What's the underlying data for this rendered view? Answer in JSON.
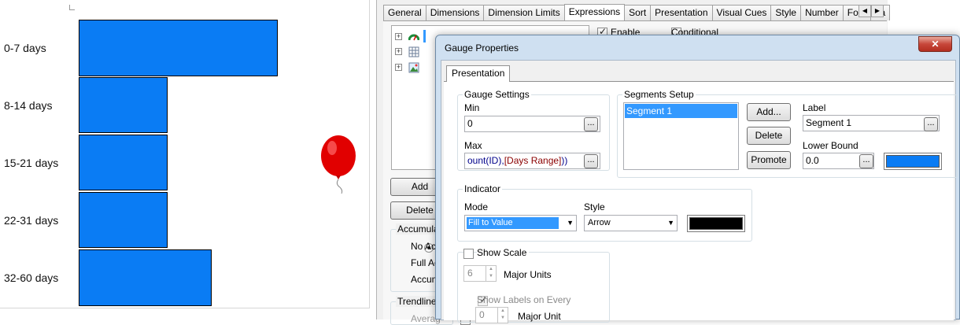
{
  "chart": {
    "categories": [
      "0-7 days",
      "8-14 days",
      "15-21 days",
      "22-31 days",
      "32-60 days"
    ],
    "bar_color": "#0a7cf4",
    "balloon_icon": "red-balloon-icon"
  },
  "chart_properties": {
    "tabs": [
      "General",
      "Dimensions",
      "Dimension Limits",
      "Expressions",
      "Sort",
      "Presentation",
      "Visual Cues",
      "Style",
      "Number",
      "Font",
      "La"
    ],
    "active_tab": "Expressions",
    "enable_label": "Enable",
    "conditional_label": "Conditional",
    "add_label": "Add",
    "delete_label": "Delete",
    "accumulation_title": "Accumulatio",
    "accumulation_options": [
      "No Acc",
      "Full Acc",
      "Accumu"
    ],
    "trendlines_title": "Trendlines",
    "trendlines_item": "Averag"
  },
  "gauge_dialog": {
    "title": "Gauge Properties",
    "close_glyph": "✕",
    "tab": "Presentation",
    "gauge_settings": {
      "title": "Gauge Settings",
      "min_label": "Min",
      "min_value": "0",
      "max_label": "Max",
      "max_value_part1": "ount(ID),",
      "max_value_part2": "[Days Range]",
      "max_value_part3": "))"
    },
    "segments": {
      "title": "Segments Setup",
      "items": [
        "Segment 1"
      ],
      "add_label": "Add...",
      "delete_label": "Delete",
      "promote_label": "Promote",
      "label_caption": "Label",
      "label_value": "Segment 1",
      "lower_bound_caption": "Lower Bound",
      "lower_bound_value": "0.0",
      "segment_color": "#0a7cf4"
    },
    "indicator": {
      "title": "Indicator",
      "mode_label": "Mode",
      "mode_value": "Fill to Value",
      "style_label": "Style",
      "style_value": "Arrow",
      "indicator_color": "#000000"
    },
    "scale": {
      "show_scale_label": "Show Scale",
      "major_units_value": "6",
      "major_units_label": "Major Units",
      "show_labels_label": "Show Labels on Every",
      "major_unit_value": "0",
      "major_unit_label": "Major Unit"
    },
    "ellipsis": "..."
  }
}
